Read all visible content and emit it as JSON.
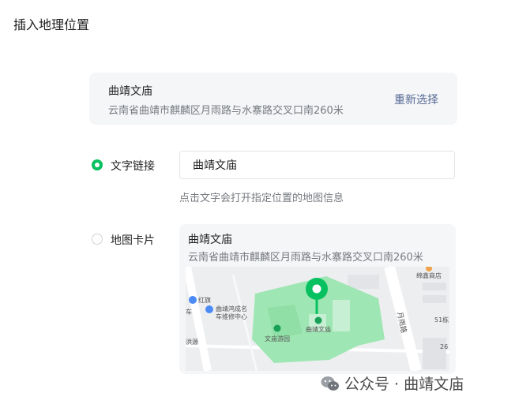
{
  "page_title": "插入地理位置",
  "location": {
    "name": "曲靖文庙",
    "address": "云南省曲靖市麒麟区月雨路与水寨路交叉口南260米",
    "reselect_label": "重新选择"
  },
  "options": [
    {
      "label": "文字链接",
      "checked": true
    },
    {
      "label": "地图卡片",
      "checked": false
    }
  ],
  "text_link": {
    "value": "曲靖文庙",
    "hint": "点击文字会打开指定位置的地图信息"
  },
  "map_card": {
    "title": "曲靖文庙",
    "address": "云南省曲靖市麒麟区月雨路与水寨路交叉口南260米",
    "map_labels": {
      "shop": "绵鑫商店",
      "hongqi": "红旗",
      "che": "车",
      "repair_line1": "曲靖鸿成名",
      "repair_line2": "车维修中心",
      "road": "月雨路",
      "wenmiao": "曲靖文庙",
      "wenmiao_park": "文庙游园",
      "num_51": "51栋",
      "num_26": "26",
      "yuan": "洪源"
    }
  },
  "watermark": "公众号 · 曲靖文庙",
  "colors": {
    "accent": "#07c160",
    "link": "#576b95",
    "pin": "#07c160"
  }
}
